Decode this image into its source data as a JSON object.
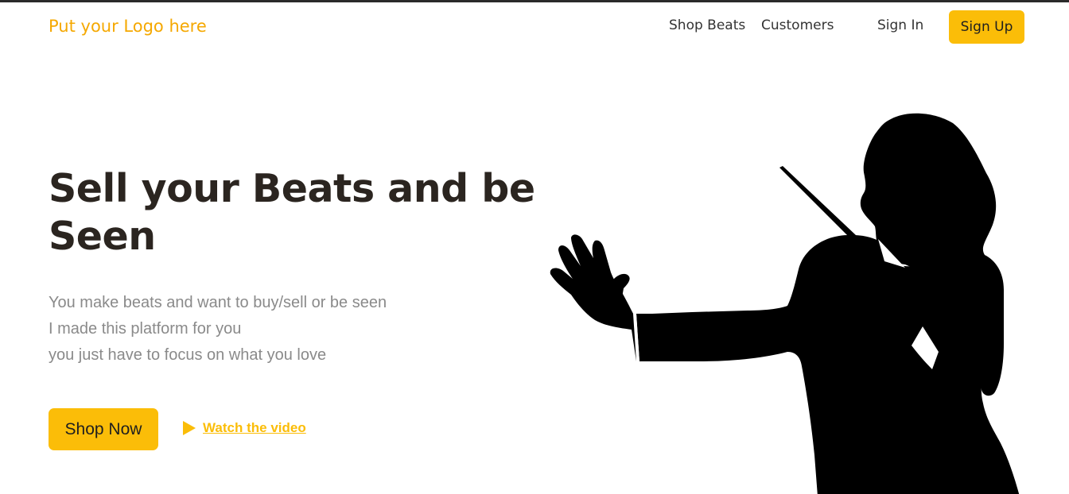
{
  "header": {
    "logo_text": "Put your Logo here",
    "nav": {
      "shop_beats": "Shop Beats",
      "customers": "Customers",
      "sign_in": "Sign In",
      "sign_up": "Sign Up"
    }
  },
  "hero": {
    "headline": "Sell your Beats and be Seen",
    "sub_lines": [
      "You make beats and want to buy/sell or be seen",
      "I made this platform for you",
      "you just have to focus on what you love"
    ],
    "shop_now_label": "Shop Now",
    "watch_video_label": "Watch the video",
    "image_icon": "conductor-silhouette"
  },
  "colors": {
    "accent": "#fbbd08",
    "logo": "#f5a800",
    "heading": "#2b2520",
    "subtext": "#8a8a8a",
    "silhouette": "#000000"
  }
}
